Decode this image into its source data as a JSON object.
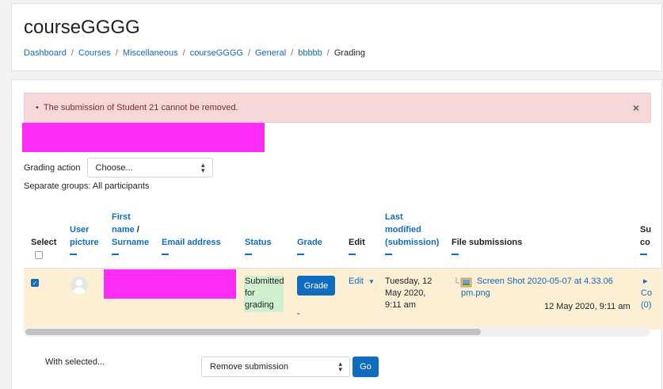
{
  "header": {
    "title": "courseGGGG",
    "breadcrumb": [
      "Dashboard",
      "Courses",
      "Miscellaneous",
      "courseGGGG",
      "General",
      "bbbbb",
      "Grading"
    ]
  },
  "alert": {
    "message": "The submission of Student 21 cannot be removed.",
    "close": "×"
  },
  "grading_action": {
    "label": "Grading action",
    "selected": "Choose..."
  },
  "groups_text": "Separate groups: All participants",
  "table": {
    "headers": {
      "select": "Select",
      "user_picture_1": "User",
      "user_picture_2": "picture",
      "first_name": "First",
      "name_slash": "name",
      "slash": " /",
      "surname": "Surname",
      "email": "Email address",
      "status": "Status",
      "grade": "Grade",
      "edit": "Edit",
      "last_modified_1": "Last",
      "last_modified_2": "modified",
      "last_modified_3": "(submission)",
      "file_submissions": "File submissions",
      "submission_comments_1": "Su",
      "submission_comments_2": "co"
    },
    "row": {
      "status_1": "Submitted",
      "status_2": "for",
      "status_3": "grading",
      "grade_button": "Grade",
      "grade_dash": "-",
      "edit": "Edit",
      "modified_1": "Tuesday, 12",
      "modified_2": "May 2020,",
      "modified_3": "9:11 am",
      "file_name_1": "Screen Shot 2020-05-07 at 4.33.06",
      "file_name_2": "pm.png",
      "file_date": "12 May 2020, 9:11 am",
      "comments_arrow": "▸",
      "comments_1": "Co",
      "comments_2": "(0)"
    }
  },
  "bulk": {
    "label": "With selected...",
    "selected": "Remove submission",
    "go": "Go"
  },
  "colors": {
    "accent": "#0f6cbf",
    "alert_bg": "#f6d8da",
    "row_bg": "#fcefd4",
    "status_bg": "#cfefcf",
    "redaction": "#ff2cf6"
  }
}
